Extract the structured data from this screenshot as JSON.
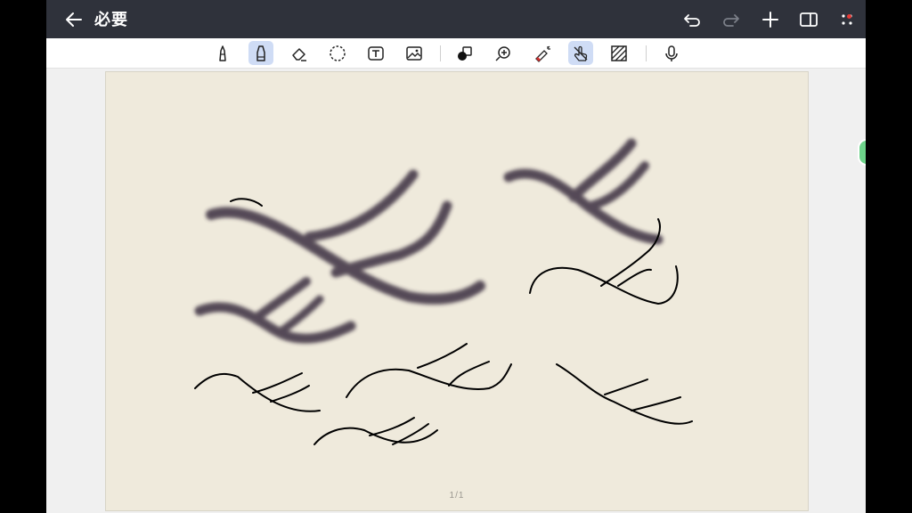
{
  "header": {
    "title": "必要",
    "actions": [
      "undo",
      "redo",
      "add-page",
      "sidebar-toggle",
      "more-menu"
    ],
    "accent_notification": "#e53935"
  },
  "toolbar": {
    "tools": [
      {
        "name": "pen-icon",
        "active": false
      },
      {
        "name": "highlighter-icon",
        "active": true
      },
      {
        "name": "eraser-icon",
        "active": false
      },
      {
        "name": "lasso-icon",
        "active": false
      },
      {
        "name": "text-box-icon",
        "active": false
      },
      {
        "name": "image-icon",
        "active": false
      },
      {
        "name": "shape-icon",
        "active": false
      },
      {
        "name": "zoom-icon",
        "active": false
      },
      {
        "name": "laser-pointer-icon",
        "active": false
      },
      {
        "name": "touch-draw-icon",
        "active": true
      },
      {
        "name": "pattern-icon",
        "active": false
      },
      {
        "name": "microphone-icon",
        "active": false
      }
    ],
    "active_color": "#cfdcf5"
  },
  "canvas": {
    "paper_color": "#efeadc",
    "ink_color": "#000000",
    "highlight_color": "#3a2f3f",
    "page_indicator": "1/1"
  }
}
